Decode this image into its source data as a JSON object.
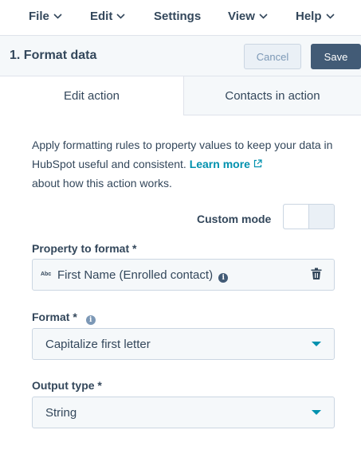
{
  "menu": {
    "items": [
      {
        "label": "File",
        "has_chevron": true
      },
      {
        "label": "Edit",
        "has_chevron": true
      },
      {
        "label": "Settings",
        "has_chevron": false
      },
      {
        "label": "View",
        "has_chevron": true
      },
      {
        "label": "Help",
        "has_chevron": true
      }
    ]
  },
  "header": {
    "title": "1. Format data",
    "cancel_label": "Cancel",
    "save_label": "Save"
  },
  "tabs": [
    {
      "label": "Edit action",
      "active": true
    },
    {
      "label": "Contacts in action",
      "active": false
    }
  ],
  "description": {
    "text_before": "Apply formatting rules to property values to keep your data in HubSpot useful and consistent. ",
    "link": "Learn more",
    "text_after": "about how this action works."
  },
  "custom_mode": {
    "label": "Custom mode",
    "enabled": false
  },
  "property_field": {
    "label": "Property to format *",
    "type_badge": "Abc",
    "value": "First Name (Enrolled contact)"
  },
  "format_field": {
    "label": "Format *",
    "value": "Capitalize first letter"
  },
  "output_field": {
    "label": "Output type *",
    "value": "String"
  },
  "colors": {
    "text": "#33475b",
    "link": "#0091ae",
    "save_bg": "#425b76",
    "border": "#cbd6e2",
    "panel_bg": "#f5f8fa"
  }
}
